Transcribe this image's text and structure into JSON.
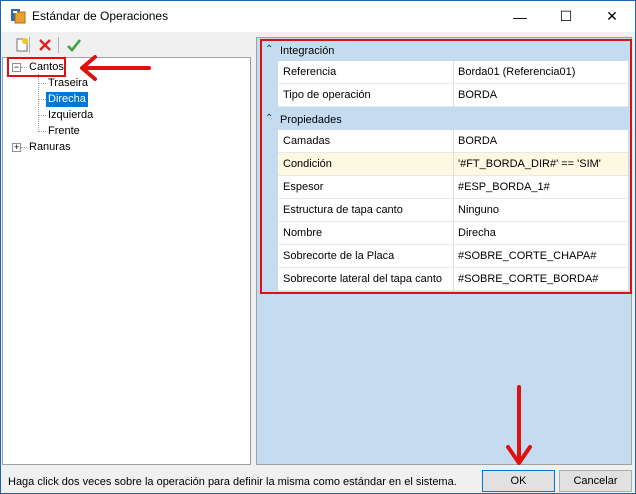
{
  "window": {
    "title": "Estándar de Operaciones",
    "minimize_glyph": "—",
    "maximize_glyph": "☐",
    "close_glyph": "✕"
  },
  "toolbar": {
    "icons": [
      "new-icon",
      "delete-icon",
      "check-icon"
    ]
  },
  "tree": {
    "nodes": [
      {
        "label": "Cantos",
        "expander": "−",
        "children": [
          {
            "label": "Traseira"
          },
          {
            "label": "Direcha",
            "selected": true
          },
          {
            "label": "Izquierda"
          },
          {
            "label": "Frente"
          }
        ]
      },
      {
        "label": "Ranuras",
        "expander": "+"
      }
    ]
  },
  "property_grid": {
    "categories": [
      {
        "label": "Integración",
        "rows": [
          {
            "name": "Referencia",
            "value": "Borda01 (Referencia01)"
          },
          {
            "name": "Tipo de operación",
            "value": "BORDA"
          }
        ]
      },
      {
        "label": "Propiedades",
        "rows": [
          {
            "name": "Camadas",
            "value": "BORDA"
          },
          {
            "name": "Condición",
            "value": "'#FT_BORDA_DIR#' == 'SIM'",
            "highlighted": true
          },
          {
            "name": "Espesor",
            "value": "#ESP_BORDA_1#"
          },
          {
            "name": "Estructura de tapa canto",
            "value": "Ninguno"
          },
          {
            "name": "Nombre",
            "value": "Direcha"
          },
          {
            "name": "Sobrecorte de la Placa",
            "value": "#SOBRE_CORTE_CHAPA#"
          },
          {
            "name": "Sobrecorte lateral del tapa canto",
            "value": "#SOBRE_CORTE_BORDA#"
          }
        ]
      }
    ]
  },
  "footer": {
    "status": "Haga click dos veces sobre la operación para definir la misma como estándar en el sistema.",
    "ok_label": "OK",
    "cancel_label": "Cancelar"
  },
  "colors": {
    "annotation_red": "#e01010",
    "selection_blue": "#0078d7",
    "grid_category_bg": "#c5dbef",
    "highlight_row": "#fdf8e2"
  }
}
